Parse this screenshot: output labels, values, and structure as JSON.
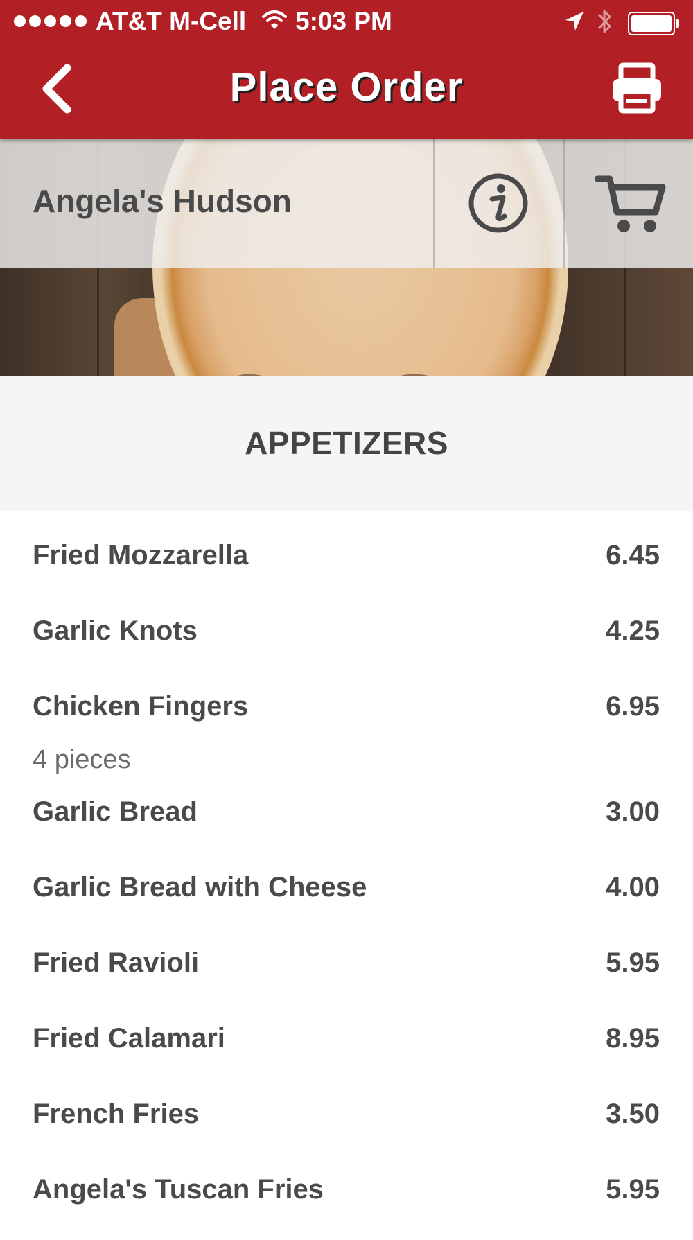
{
  "status_bar": {
    "carrier": "AT&T M-Cell",
    "time": "5:03 PM",
    "icons": [
      "signal-dots-icon",
      "wifi-icon",
      "location-arrow-icon",
      "bluetooth-icon",
      "battery-icon"
    ]
  },
  "header": {
    "title": "Place Order",
    "back_icon": "chevron-left-icon",
    "print_icon": "printer-icon",
    "color": "#b21f24"
  },
  "store": {
    "name": "Angela's Hudson",
    "info_icon": "info-icon",
    "cart_icon": "cart-icon"
  },
  "category": {
    "title": "APPETIZERS"
  },
  "menu_items": [
    {
      "name": "Fried Mozzarella",
      "price": "6.45"
    },
    {
      "name": "Garlic Knots",
      "price": "4.25"
    },
    {
      "name": "Chicken Fingers",
      "price": "6.95",
      "description": "4 pieces"
    },
    {
      "name": "Garlic Bread",
      "price": "3.00"
    },
    {
      "name": "Garlic Bread with Cheese",
      "price": "4.00"
    },
    {
      "name": "Fried Ravioli",
      "price": "5.95"
    },
    {
      "name": "Fried Calamari",
      "price": "8.95"
    },
    {
      "name": "French Fries",
      "price": "3.50"
    },
    {
      "name": "Angela's Tuscan Fries",
      "price": "5.95"
    }
  ]
}
